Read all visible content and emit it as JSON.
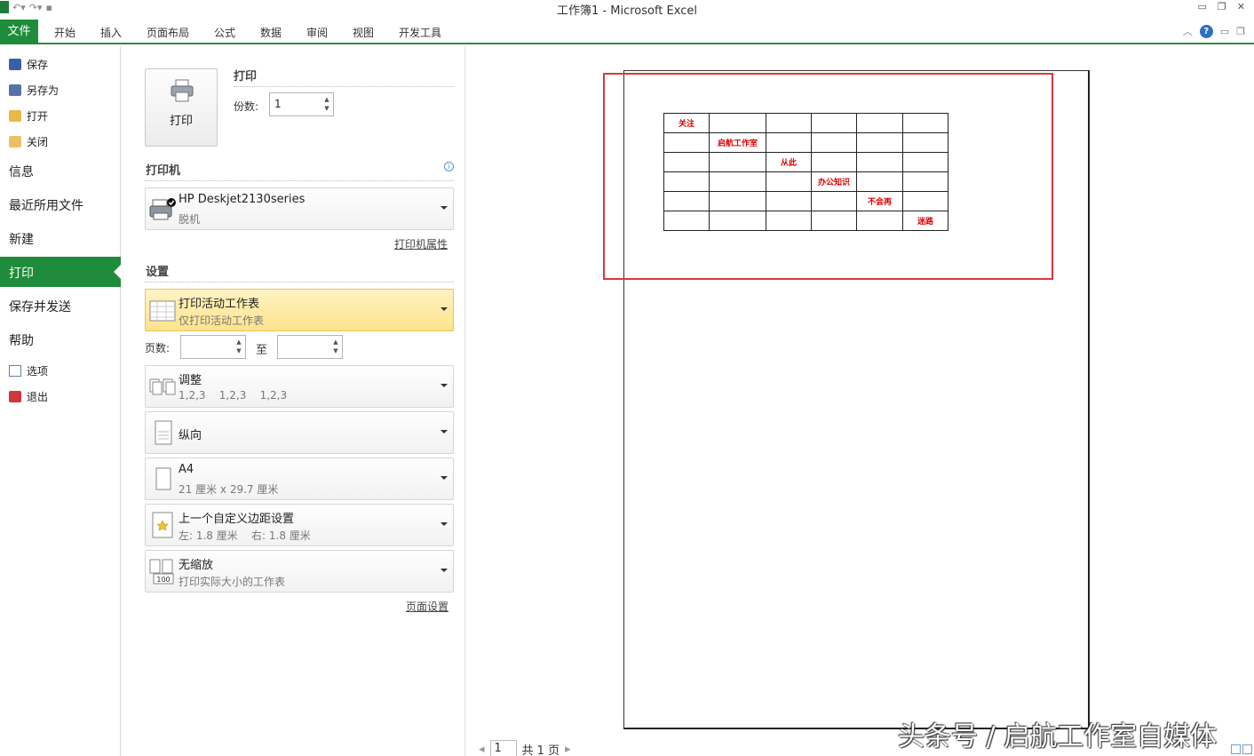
{
  "window": {
    "title": "工作簿1 - Microsoft Excel"
  },
  "ribbon": {
    "file_tab": "文件",
    "tabs": [
      "开始",
      "插入",
      "页面布局",
      "公式",
      "数据",
      "审阅",
      "视图",
      "开发工具"
    ]
  },
  "nav": {
    "save": "保存",
    "save_as": "另存为",
    "open": "打开",
    "close": "关闭",
    "info": "信息",
    "recent": "最近所用文件",
    "new": "新建",
    "print": "打印",
    "save_send": "保存并发送",
    "help": "帮助",
    "options": "选项",
    "exit": "退出"
  },
  "print_panel": {
    "print_button": "打印",
    "print_title": "打印",
    "copies_label": "份数:",
    "copies_value": "1",
    "printer_title": "打印机",
    "printer_name": "HP Deskjet2130series",
    "printer_status": "脱机",
    "printer_props": "打印机属性",
    "settings_title": "设置",
    "scope_main": "打印活动工作表",
    "scope_sub": "仅打印活动工作表",
    "pages_label": "页数:",
    "to_label": "至",
    "collate_main": "调整",
    "collate_sub": "1,2,3    1,2,3    1,2,3",
    "orientation": "纵向",
    "paper_main": "A4",
    "paper_sub": "21 厘米 x 29.7 厘米",
    "margins_main": "上一个自定义边距设置",
    "margins_sub": "左: 1.8 厘米    右: 1.8 厘米",
    "scaling_main": "无缩放",
    "scaling_sub": "打印实际大小的工作表",
    "page_setup": "页面设置"
  },
  "preview": {
    "cells": [
      [
        "关注",
        "",
        "",
        "",
        "",
        ""
      ],
      [
        "",
        "启航工作室",
        "",
        "",
        "",
        ""
      ],
      [
        "",
        "",
        "从此",
        "",
        "",
        ""
      ],
      [
        "",
        "",
        "",
        "办公知识",
        "",
        ""
      ],
      [
        "",
        "",
        "",
        "",
        "不会再",
        ""
      ],
      [
        "",
        "",
        "",
        "",
        "",
        "迷路"
      ]
    ],
    "page_number": "1",
    "page_total": "共 1 页",
    "watermark": "头条号 / 启航工作室自媒体"
  },
  "colors": {
    "accent": "#1f8c3b",
    "highlight_box": "#d9373a",
    "cell_text": "#e00000"
  }
}
